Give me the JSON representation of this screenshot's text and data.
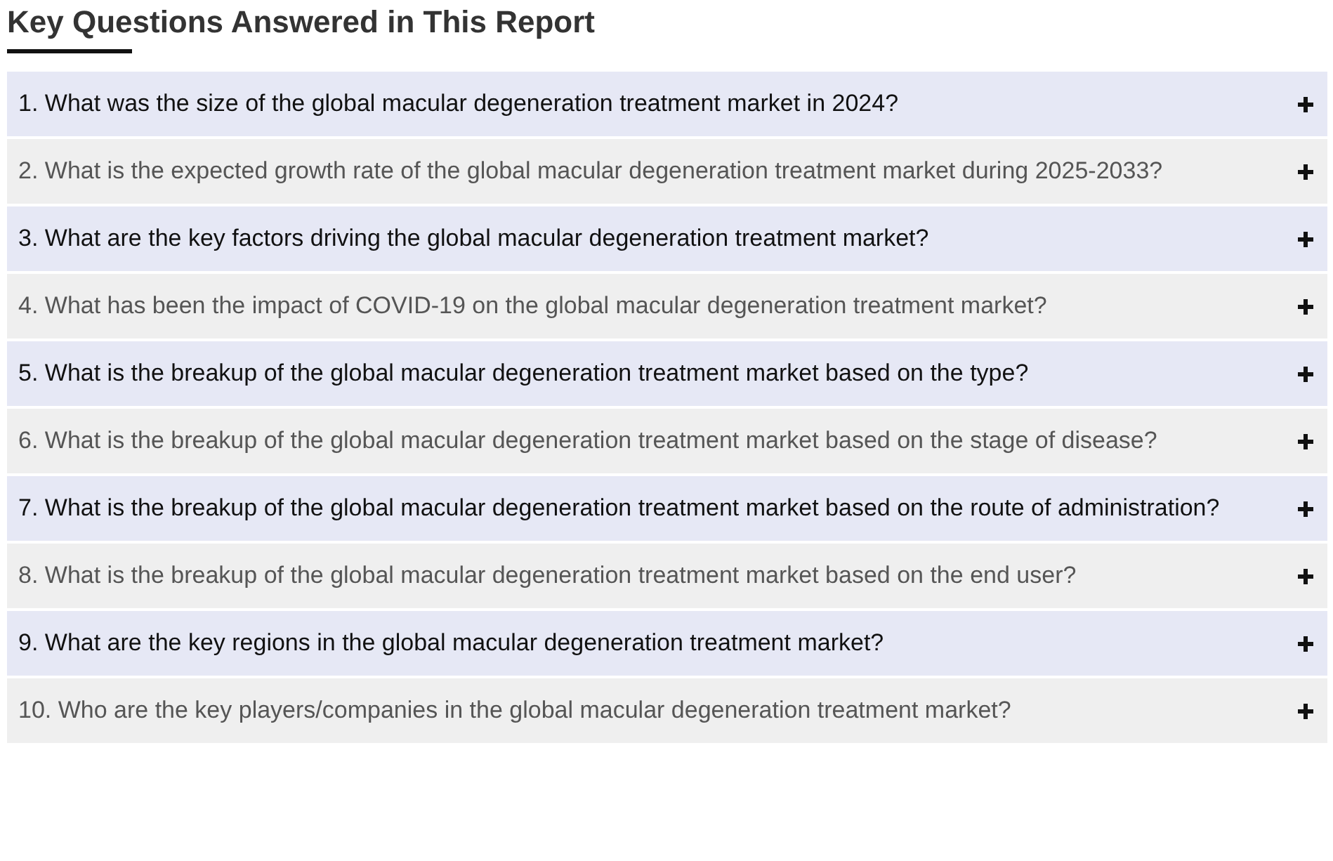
{
  "title": "Key Questions Answered in This Report",
  "questions": [
    {
      "text": "1. What was the size of the global macular degeneration treatment market in 2024?"
    },
    {
      "text": "2. What is the expected growth rate of the global macular degeneration treatment market during 2025-2033?"
    },
    {
      "text": "3. What are the key factors driving the global macular degeneration treatment market?"
    },
    {
      "text": "4. What has been the impact of COVID-19 on the global macular degeneration treatment market?"
    },
    {
      "text": "5. What is the breakup of the global macular degeneration treatment market based on the type?"
    },
    {
      "text": "6. What is the breakup of the global macular degeneration treatment market based on the stage of disease?"
    },
    {
      "text": "7. What is the breakup of the global macular degeneration treatment market based on the route of administration?"
    },
    {
      "text": "8. What is the breakup of the global macular degeneration treatment market based on the end user?"
    },
    {
      "text": "9. What are the key regions in the global macular degeneration treatment market?"
    },
    {
      "text": "10. Who are the key players/companies in the global macular degeneration treatment market?"
    }
  ]
}
